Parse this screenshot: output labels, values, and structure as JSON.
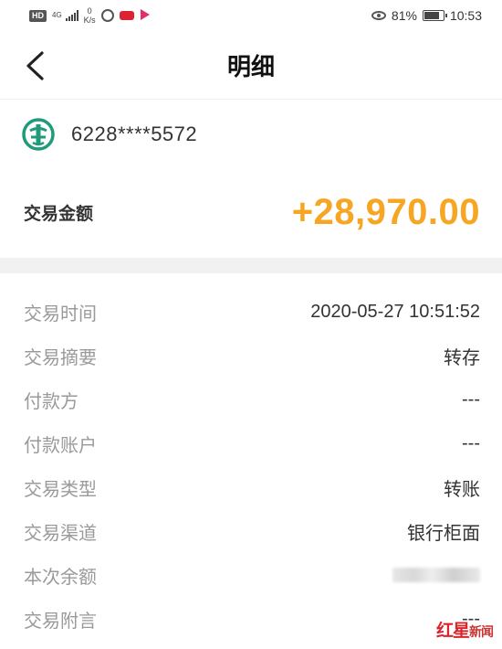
{
  "status_bar": {
    "hd": "HD",
    "network": "4G",
    "speed_value": "0",
    "speed_unit": "K/s",
    "battery": "81%",
    "time": "10:53",
    "battery_level": 0.81
  },
  "nav": {
    "title": "明细"
  },
  "account": {
    "number": "6228****5572"
  },
  "amount": {
    "label": "交易金额",
    "value": "+28,970.00",
    "color": "#f6a623"
  },
  "details": [
    {
      "label": "交易时间",
      "value": "2020-05-27 10:51:52"
    },
    {
      "label": "交易摘要",
      "value": "转存"
    },
    {
      "label": "付款方",
      "value": "---"
    },
    {
      "label": "付款账户",
      "value": "---"
    },
    {
      "label": "交易类型",
      "value": "转账"
    },
    {
      "label": "交易渠道",
      "value": "银行柜面"
    },
    {
      "label": "本次余额",
      "value": ""
    },
    {
      "label": "交易附言",
      "value": "---"
    }
  ],
  "watermark": {
    "text": "红星",
    "suffix": "新闻"
  },
  "colors": {
    "amount": "#f6a623",
    "bank_logo": "#1f9a7a",
    "label_gray": "#9a9a9a"
  }
}
